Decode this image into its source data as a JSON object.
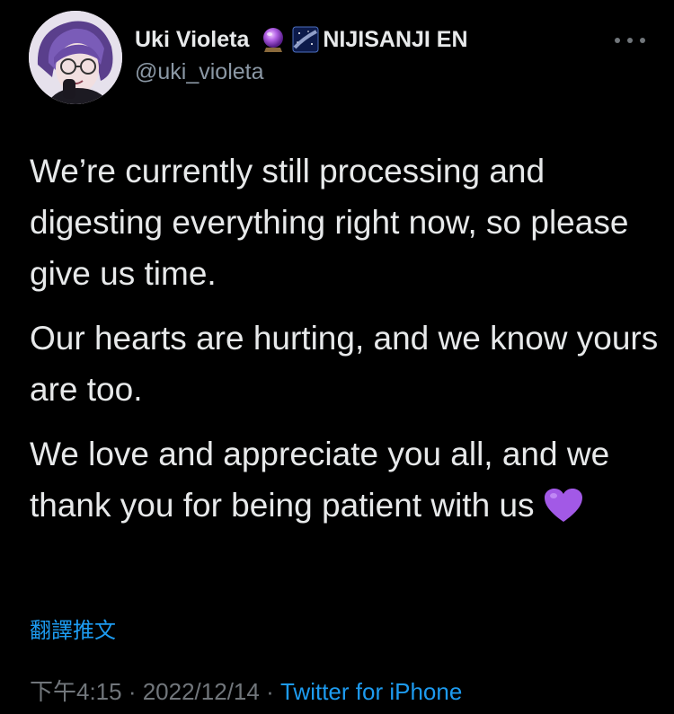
{
  "user": {
    "display_name": "Uki Violeta",
    "emoji_1": "crystal-ball-emoji",
    "emoji_2": "milky-way-emoji",
    "affiliation": "NIJISANJI EN",
    "handle": "@uki_violeta"
  },
  "tweet": {
    "paragraphs": [
      "We’re currently still processing and digesting everything right now, so please give us time.",
      "Our hearts are hurting, and we know yours are too.",
      "We love and appreciate you all, and we thank you for being patient with us"
    ],
    "trailing_emoji": "purple-heart-emoji",
    "translate_label": "翻譯推文",
    "time": "下午4:15",
    "separator": " · ",
    "date": "2022/12/14",
    "source": "Twitter for iPhone"
  },
  "colors": {
    "background": "#000000",
    "text": "#e7e9ea",
    "secondary": "#71767b",
    "link": "#1d9bf0",
    "heart": "#a259e6"
  }
}
